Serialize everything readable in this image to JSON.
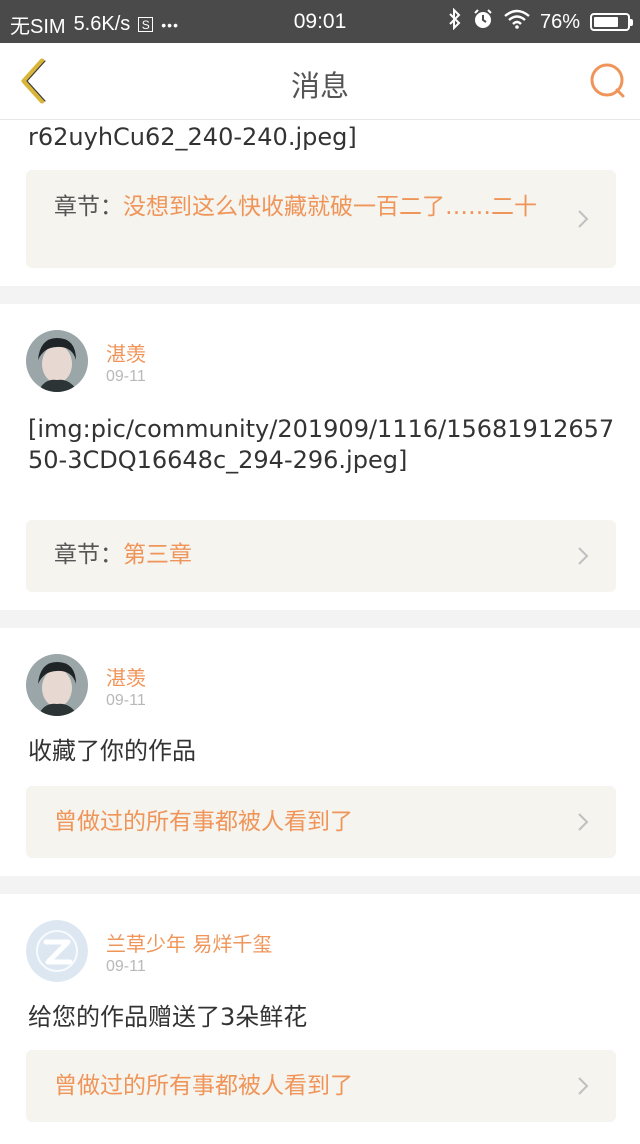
{
  "status_bar": {
    "carrier": "无SIM",
    "speed": "5.6K/s",
    "s_badge": "S",
    "dots": "•••",
    "time": "09:01",
    "battery": "76%",
    "battery_level": 0.76
  },
  "nav": {
    "title": "消息",
    "back_icon": "chevron-left-icon",
    "search_icon": "search-icon"
  },
  "messages": [
    {
      "body": "r62uyhCu62_240-240.jpeg]",
      "ref_label": "章节：",
      "ref_text": "没想到这么快收藏就破一百二了……二十"
    },
    {
      "user": "湛羡",
      "date": "09-11",
      "body": "[img:pic/community/201909/1116/1568191265750-3CDQ16648c_294-296.jpeg]",
      "ref_label": "章节：",
      "ref_text": "第三章"
    },
    {
      "user": "湛羡",
      "date": "09-11",
      "body": "收藏了你的作品",
      "ref_text": "曾做过的所有事都被人看到了"
    },
    {
      "user": "兰草少年 易烊千玺",
      "date": "09-11",
      "body": "给您的作品赠送了3朵鲜花",
      "ref_text": "曾做过的所有事都被人看到了"
    }
  ],
  "colors": {
    "accent": "#f0955a",
    "back_icon": "#d9b53a",
    "ref_bg": "#f5f4ee"
  }
}
